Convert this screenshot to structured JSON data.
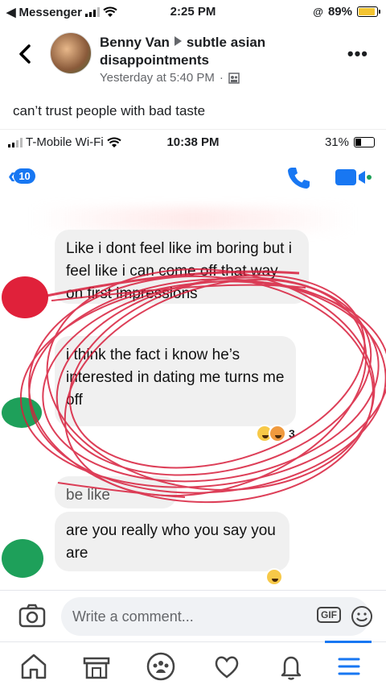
{
  "status_bar": {
    "carrier": "Messenger",
    "time": "2:25 PM",
    "battery": "89%",
    "battery_level": 0.89
  },
  "post": {
    "author": "Benny Van",
    "group": "subtle asian disappointments",
    "timestamp": "Yesterday at 5:40 PM",
    "separator": "·",
    "caption": "can’t trust people with bad taste",
    "more_label": "•••"
  },
  "embedded": {
    "carrier": "T-Mobile Wi-Fi",
    "time": "10:38 PM",
    "battery": "31%",
    "battery_level": 0.31,
    "back_count": "10",
    "messages": [
      {
        "text": "Like i dont feel like im boring but i feel like i can come off that way on first impressions"
      },
      {
        "text": "i think the fact i know he’s interested in dating me turns me off"
      },
      {
        "text": "be like"
      },
      {
        "text": "are you really who you say you are"
      }
    ],
    "reaction_count": "3"
  },
  "comment": {
    "placeholder": "Write a comment...",
    "gif_label": "GIF"
  },
  "colors": {
    "accent": "#1877f2",
    "scribble": "#d81e3c"
  }
}
